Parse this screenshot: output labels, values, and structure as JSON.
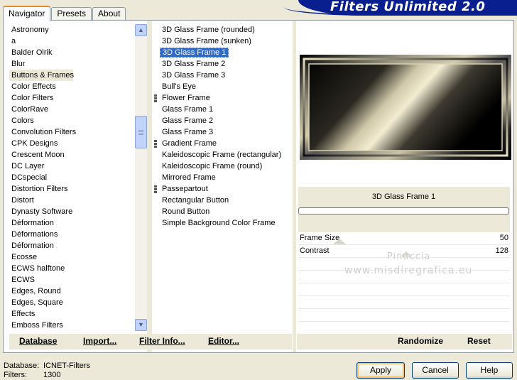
{
  "tabs": [
    "Navigator",
    "Presets",
    "About"
  ],
  "brand": "Filters Unlimited 2.0",
  "categories": [
    "Astronomy",
    "a",
    "Balder Olrik",
    "Blur",
    "Buttons & Frames",
    "Color Effects",
    "Color Filters",
    "ColorRave",
    "Colors",
    "Convolution Filters",
    "CPK Designs",
    "Crescent Moon",
    "DC Layer",
    "DCspecial",
    "Distortion Filters",
    "Distort",
    "Dynasty Software",
    "Déformation",
    "Déformations",
    "Déformation",
    "Ecosse",
    "ECWS halftone",
    "ECWS",
    "Edges, Round",
    "Edges, Square",
    "Effects",
    "Emboss Filters"
  ],
  "selected_category": "Buttons & Frames",
  "filters": [
    {
      "label": "3D Glass Frame (rounded)",
      "mark": false
    },
    {
      "label": "3D Glass Frame (sunken)",
      "mark": false
    },
    {
      "label": "3D Glass Frame 1",
      "mark": false
    },
    {
      "label": "3D Glass Frame 2",
      "mark": false
    },
    {
      "label": "3D Glass Frame 3",
      "mark": false
    },
    {
      "label": "Bull's Eye",
      "mark": false
    },
    {
      "label": "Flower Frame",
      "mark": true
    },
    {
      "label": "Glass Frame 1",
      "mark": false
    },
    {
      "label": "Glass Frame 2",
      "mark": false
    },
    {
      "label": "Glass Frame 3",
      "mark": false
    },
    {
      "label": "Gradient Frame",
      "mark": true
    },
    {
      "label": "Kaleidoscopic Frame (rectangular)",
      "mark": false
    },
    {
      "label": "Kaleidoscopic Frame (round)",
      "mark": false
    },
    {
      "label": "Mirrored Frame",
      "mark": false
    },
    {
      "label": "Passepartout",
      "mark": true
    },
    {
      "label": "Rectangular Button",
      "mark": false
    },
    {
      "label": "Round Button",
      "mark": false
    },
    {
      "label": "Simple Background Color Frame",
      "mark": false
    }
  ],
  "selected_filter": "3D Glass Frame 1",
  "preview": {
    "filter_name": "3D Glass Frame 1"
  },
  "params": [
    {
      "name": "Frame Size",
      "value": "50"
    },
    {
      "name": "Contrast",
      "value": "128"
    }
  ],
  "watermark": {
    "line1": "Pinuccia",
    "line2": "www.misdiregrafica.eu"
  },
  "toolbar": {
    "database": "Database",
    "import": "Import...",
    "filter_info": "Filter Info...",
    "editor": "Editor...",
    "randomize": "Randomize",
    "reset": "Reset"
  },
  "info": {
    "database_label": "Database:",
    "database_value": "ICNET-Filters",
    "filters_label": "Filters:",
    "filters_value": "1300"
  },
  "buttons": {
    "apply": "Apply",
    "cancel": "Cancel",
    "help": "Help"
  },
  "colors": {
    "selection": "#316ac5",
    "brand": "#0a1f8f",
    "panel": "#ece9d8",
    "active_tab_accent": "#e68b2c"
  }
}
